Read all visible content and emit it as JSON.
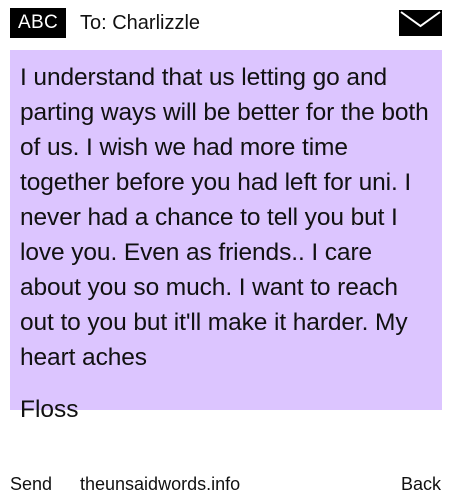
{
  "header": {
    "mode_badge": "ABC",
    "recipient": "To: Charlizzle",
    "mail_icon": "envelope-icon"
  },
  "message": {
    "body": "I understand that us letting go and parting ways will be better for the both of us. I wish we had more time together before you had left for uni. I never had a chance to tell you but I love you. Even as friends.. I care about you so much. I want to reach out to you but it'll make it harder. My heart aches",
    "signature": "Floss",
    "background_color": "#dcc5ff"
  },
  "footer": {
    "left_softkey": "Send",
    "center_text": "theunsaidwords.info",
    "right_softkey": "Back"
  }
}
